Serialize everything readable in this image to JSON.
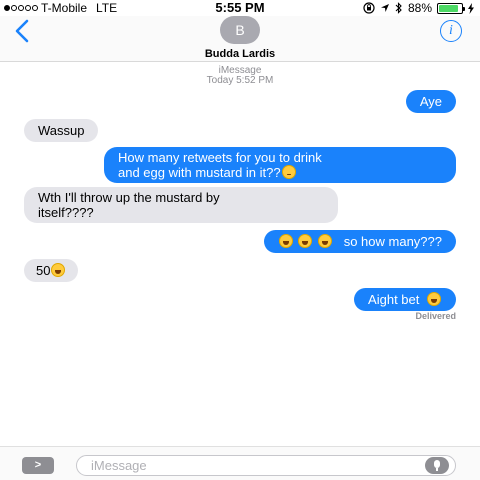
{
  "status_bar": {
    "carrier": "T-Mobile",
    "network": "LTE",
    "time": "5:55 PM",
    "battery_percent": "88%",
    "battery_level": 0.88,
    "battery_color": "#4cd964"
  },
  "header": {
    "avatar_initial": "B",
    "contact_name": "Budda Lardis",
    "back_icon": "chevron-left-icon",
    "info_icon": "info-icon",
    "info_label": "i"
  },
  "thread": {
    "service": "iMessage",
    "timestamp": "Today 5:52 PM"
  },
  "messages": [
    {
      "from": "me",
      "text": "Aye"
    },
    {
      "from": "them",
      "text": "Wassup"
    },
    {
      "from": "me",
      "lines": [
        "How many retweets for you to drink",
        "and egg with mustard in it??"
      ],
      "emoji": "thinking-face"
    },
    {
      "from": "them",
      "lines": [
        "Wth I'll throw up the mustard by",
        "itself????"
      ]
    },
    {
      "from": "me",
      "text": "so how many???",
      "emoji": "tears-of-joy-x3"
    },
    {
      "from": "them",
      "text": "50",
      "emoji": "tears-of-joy"
    },
    {
      "from": "me",
      "text": "Aight bet",
      "emoji": "tears-of-joy"
    }
  ],
  "delivered_label": "Delivered",
  "input": {
    "placeholder": "iMessage",
    "apps_label": ">"
  },
  "colors": {
    "outgoing_bubble": "#1a82fb",
    "incoming_bubble": "#e5e5ea",
    "accent": "#1a82fb"
  }
}
